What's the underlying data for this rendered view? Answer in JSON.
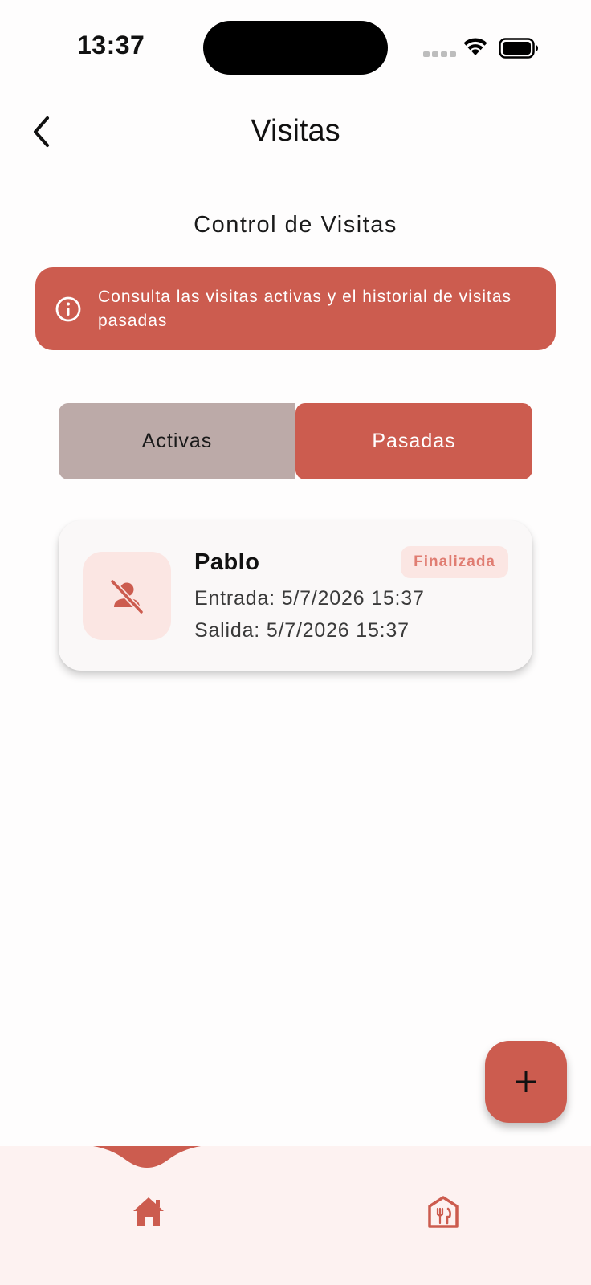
{
  "status_bar": {
    "time": "13:37"
  },
  "header": {
    "title": "Visitas",
    "back_icon": "chevron-left-icon"
  },
  "section": {
    "title": "Control de Visitas"
  },
  "info_banner": {
    "icon": "info-icon",
    "text": "Consulta las visitas activas y el historial de visitas pasadas"
  },
  "tabs": [
    {
      "label": "Activas",
      "selected": false
    },
    {
      "label": "Pasadas",
      "selected": true
    }
  ],
  "visits": [
    {
      "name": "Pablo",
      "status": "Finalizada",
      "entry": "Entrada: 5/7/2026 15:37",
      "exit": "Salida: 5/7/2026 15:37",
      "icon": "person-off-icon"
    }
  ],
  "fab": {
    "icon": "plus-icon"
  },
  "bottom_nav": [
    {
      "icon": "home-icon",
      "selected": true
    },
    {
      "icon": "restaurant-icon",
      "selected": false
    }
  ],
  "colors": {
    "primary": "#cc5c4f",
    "tab_inactive": "#bcaaa8",
    "badge_bg": "#fbe6e3",
    "badge_text": "#e07d72",
    "nav_bg": "#fdf2f1"
  }
}
